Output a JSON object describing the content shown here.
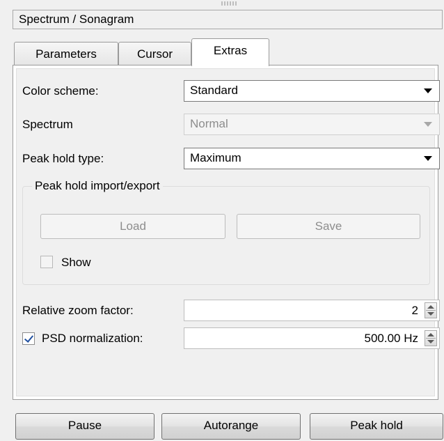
{
  "panel": {
    "title": "Spectrum / Sonagram"
  },
  "tabs": [
    {
      "label": "Parameters",
      "active": false
    },
    {
      "label": "Cursor",
      "active": false
    },
    {
      "label": "Extras",
      "active": true
    }
  ],
  "extras": {
    "color_scheme": {
      "label": "Color scheme:",
      "value": "Standard"
    },
    "spectrum": {
      "label": "Spectrum",
      "value": "Normal",
      "enabled": false
    },
    "peak_hold_type": {
      "label": "Peak hold type:",
      "value": "Maximum"
    },
    "peak_hold_io": {
      "title": "Peak hold import/export",
      "load_label": "Load",
      "save_label": "Save",
      "show_label": "Show",
      "show_checked": false,
      "enabled": false
    },
    "relative_zoom": {
      "label": "Relative zoom factor:",
      "value": "2"
    },
    "psd_normalization": {
      "label": "PSD normalization:",
      "value": "500.00 Hz",
      "checked": true
    }
  },
  "bottom_buttons": {
    "pause": "Pause",
    "autorange": "Autorange",
    "peak_hold": "Peak hold"
  },
  "colors": {
    "window_bg": "#f0f0f0",
    "field_bg": "#ffffff",
    "disabled_text": "#8d8d8d"
  }
}
